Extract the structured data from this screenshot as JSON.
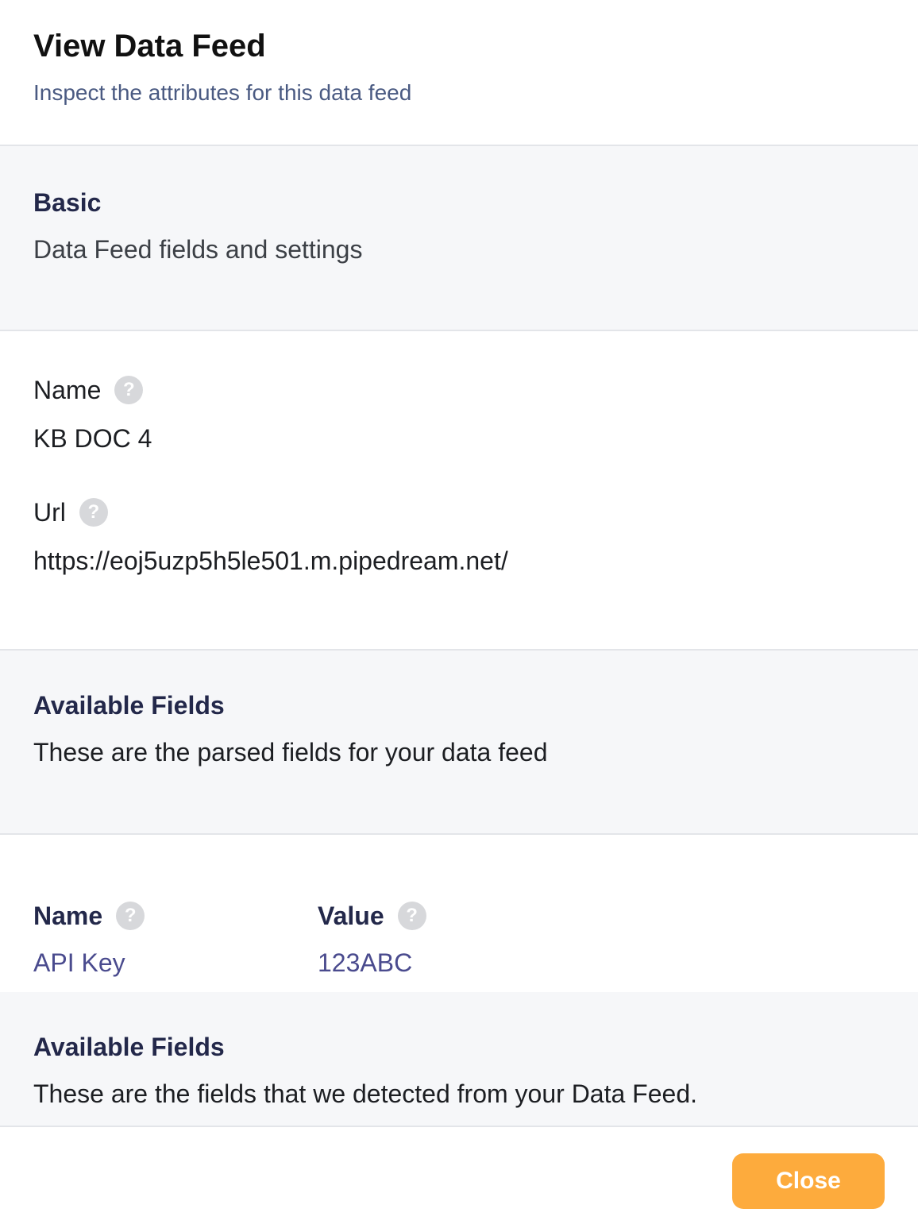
{
  "header": {
    "title": "View Data Feed",
    "subtitle": "Inspect the attributes for this data feed"
  },
  "basic_section": {
    "title": "Basic",
    "description": "Data Feed fields and settings"
  },
  "fields": {
    "name": {
      "label": "Name",
      "help_icon": "question-mark",
      "value": "KB DOC 4"
    },
    "url": {
      "label": "Url",
      "help_icon": "question-mark",
      "value": "https://eoj5uzp5h5le501.m.pipedream.net/"
    }
  },
  "parsed_fields_section": {
    "title": "Available Fields",
    "description": "These are the parsed fields for your data feed"
  },
  "field_table": {
    "columns": [
      {
        "label": "Name",
        "help_icon": "question-mark"
      },
      {
        "label": "Value",
        "help_icon": "question-mark"
      }
    ],
    "rows": [
      {
        "name": "API Key",
        "value": "123ABC"
      }
    ]
  },
  "detected_fields_section": {
    "title": "Available Fields",
    "description": "These are the fields that we detected from your Data Feed."
  },
  "footer": {
    "close_label": "Close"
  },
  "help_glyph": "?",
  "colors": {
    "accent_button": "#fdab3d",
    "section_title": "#23284a",
    "link_text": "#4a4b8e",
    "subtitle": "#4a5a82"
  }
}
